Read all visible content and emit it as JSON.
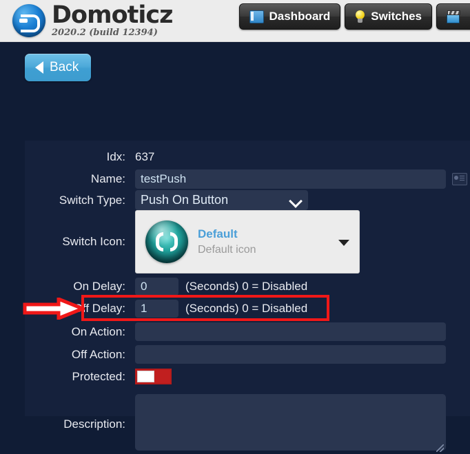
{
  "header": {
    "brand_name": "Domoticz",
    "version": "2020.2 (build 12394)",
    "logo_icon": "domoticz-logo-icon",
    "nav": [
      {
        "label": "Dashboard",
        "icon": "dashboard-icon"
      },
      {
        "label": "Switches",
        "icon": "lightbulb-icon"
      },
      {
        "label": "",
        "icon": "scenes-icon"
      }
    ]
  },
  "toolbar": {
    "back_label": "Back",
    "back_icon": "left-triangle-icon"
  },
  "form": {
    "idx": {
      "label": "Idx:",
      "value": "637"
    },
    "name": {
      "label": "Name:",
      "value": "testPush",
      "trailing_icon": "contact-card-icon"
    },
    "switch_type": {
      "label": "Switch Type:",
      "value": "Push On Button",
      "caret_icon": "chevron-down-icon"
    },
    "switch_icon": {
      "label": "Switch Icon:",
      "title": "Default",
      "subtitle": "Default icon",
      "preview_icon": "default-switch-sphere-icon",
      "caret_icon": "caret-down-icon"
    },
    "on_delay": {
      "label": "On Delay:",
      "value": "0",
      "hint": "(Seconds) 0 = Disabled"
    },
    "off_delay": {
      "label": "Off Delay:",
      "value": "1",
      "hint": "(Seconds) 0 = Disabled"
    },
    "on_action": {
      "label": "On Action:",
      "value": "",
      "placeholder": ""
    },
    "off_action": {
      "label": "Off Action:",
      "value": "",
      "placeholder": ""
    },
    "protected": {
      "label": "Protected:",
      "state": "off"
    },
    "description": {
      "label": "Description:",
      "value": "",
      "placeholder": ""
    }
  },
  "annotations": {
    "highlight_target": "off-delay-row",
    "arrow_icon": "right-arrow-annotation",
    "color": "#f01818"
  }
}
